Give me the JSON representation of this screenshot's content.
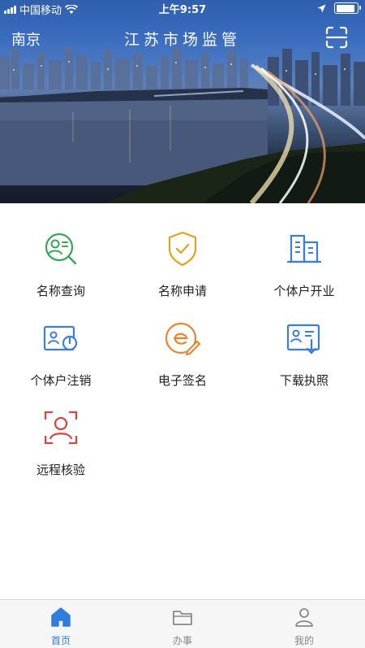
{
  "status_bar": {
    "carrier": "中国移动",
    "time": "上午9:57",
    "battery_level": 0.9
  },
  "header": {
    "city": "南京",
    "title": "江苏市场监管",
    "scan_icon": "scan-icon"
  },
  "services": [
    {
      "label": "名称查询",
      "icon": "name-search-icon",
      "color": "#3aa457"
    },
    {
      "label": "名称申请",
      "icon": "shield-check-icon",
      "color": "#e5a21b"
    },
    {
      "label": "个体户开业",
      "icon": "buildings-icon",
      "color": "#3b7dd8"
    },
    {
      "label": "个体户注销",
      "icon": "id-card-power-icon",
      "color": "#3b7dd8"
    },
    {
      "label": "电子签名",
      "icon": "e-signature-icon",
      "color": "#e8842c"
    },
    {
      "label": "下载执照",
      "icon": "license-download-icon",
      "color": "#3b7dd8"
    },
    {
      "label": "远程核验",
      "icon": "face-verify-icon",
      "color": "#d9443b"
    }
  ],
  "tabbar": {
    "tabs": [
      {
        "label": "首页",
        "icon": "home-icon",
        "active": true
      },
      {
        "label": "办事",
        "icon": "folder-icon",
        "active": false
      },
      {
        "label": "我的",
        "icon": "user-icon",
        "active": false
      }
    ],
    "active_color": "#2f7de1",
    "inactive_color": "#888888"
  }
}
